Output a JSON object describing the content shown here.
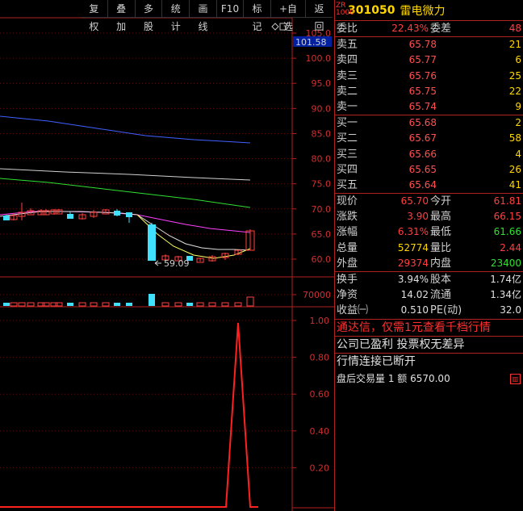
{
  "toolbar": {
    "buttons": [
      "复权",
      "叠加",
      "多股",
      "统计",
      "画线",
      "F10",
      "标记",
      "+自选",
      "返回"
    ]
  },
  "chart": {
    "price_axis": [
      "105.0",
      "100.0",
      "95.0",
      "90.0",
      "85.0",
      "80.0",
      "75.0",
      "70.0",
      "65.0",
      "60.0"
    ],
    "current_price_tag": "101.58",
    "low_marker": "59.09",
    "volume_axis": [
      "70000"
    ],
    "indicator_axis": [
      "1.00",
      "0.80",
      "0.60",
      "0.40",
      "0.20"
    ],
    "colors": {
      "up": "#ff4040",
      "down": "#40e0ff",
      "ma1": "#e0e0e0",
      "ma2": "#ff40ff",
      "ma3": "#30e030",
      "ma4": "#d0d0d0",
      "ma5": "#4060ff",
      "ma6": "#ffff60"
    }
  },
  "panel": {
    "badge": "ZR\n1000",
    "code": "301050",
    "name": "雷电微力",
    "ratio": {
      "label": "委比",
      "value": "22.43%",
      "label2": "委差",
      "value2": "48"
    },
    "sell": [
      {
        "label": "卖五",
        "price": "65.78",
        "vol": "21"
      },
      {
        "label": "卖四",
        "price": "65.77",
        "vol": "6"
      },
      {
        "label": "卖三",
        "price": "65.76",
        "vol": "25"
      },
      {
        "label": "卖二",
        "price": "65.75",
        "vol": "22"
      },
      {
        "label": "卖一",
        "price": "65.74",
        "vol": "9"
      }
    ],
    "buy": [
      {
        "label": "买一",
        "price": "65.68",
        "vol": "2"
      },
      {
        "label": "买二",
        "price": "65.67",
        "vol": "58"
      },
      {
        "label": "买三",
        "price": "65.66",
        "vol": "4"
      },
      {
        "label": "买四",
        "price": "65.65",
        "vol": "26"
      },
      {
        "label": "买五",
        "price": "65.64",
        "vol": "41"
      }
    ],
    "quote": [
      {
        "l1": "现价",
        "v1": "65.70",
        "c1": "red",
        "l2": "今开",
        "v2": "61.81",
        "c2": "red"
      },
      {
        "l1": "涨跌",
        "v1": "3.90",
        "c1": "red",
        "l2": "最高",
        "v2": "66.15",
        "c2": "red"
      },
      {
        "l1": "涨幅",
        "v1": "6.31%",
        "c1": "red",
        "l2": "最低",
        "v2": "61.66",
        "c2": "green"
      },
      {
        "l1": "总量",
        "v1": "52774",
        "c1": "yellow",
        "l2": "量比",
        "v2": "2.44",
        "c2": "red"
      },
      {
        "l1": "外盘",
        "v1": "29374",
        "c1": "red",
        "l2": "内盘",
        "v2": "23400",
        "c2": "green"
      }
    ],
    "fund": [
      {
        "l1": "换手",
        "v1": "3.94%",
        "c1": "white",
        "l2": "股本",
        "v2": "1.74亿",
        "c2": "white"
      },
      {
        "l1": "净资",
        "v1": "14.02",
        "c1": "white",
        "l2": "流通",
        "v2": "1.34亿",
        "c2": "white"
      },
      {
        "l1": "收益㈠",
        "v1": "0.510",
        "c1": "white",
        "l2": "PE(动)",
        "v2": "32.0",
        "c2": "white"
      }
    ],
    "ad_text": "通达信，仅需1元查看千档行情",
    "notice_text": "公司已盈利 投票权无差异",
    "status_text": "行情连接已断开",
    "after_hours": "盘后交易量 1 额 6570.00"
  }
}
